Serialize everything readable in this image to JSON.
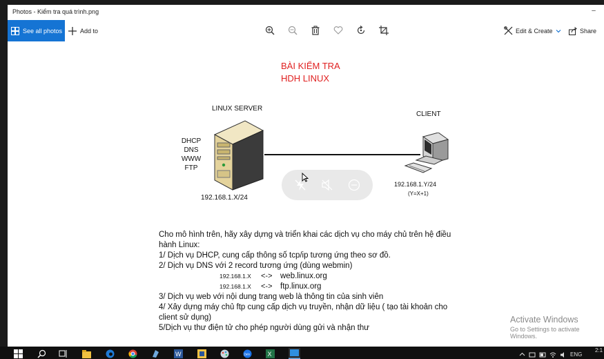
{
  "window": {
    "title": "Photos - Kiểm tra quá trình.png",
    "minimize_glyph": "–"
  },
  "toolbar": {
    "see_all_photos_label": "See all photos",
    "add_to_label": "Add to",
    "edit_create_label": "Edit & Create",
    "share_label": "Share",
    "accent_color": "#1574d4",
    "icons": [
      "zoom-in-icon",
      "zoom-out-icon",
      "delete-icon",
      "favorite-icon",
      "rotate-icon",
      "crop-icon"
    ]
  },
  "document": {
    "title_line1": "BÀI KIỂM TRA",
    "title_line2": "HDH LINUX",
    "title_color": "#e02020",
    "server_label": "LINUX SERVER",
    "client_label": "CLIENT",
    "services": [
      "DHCP",
      "DNS",
      "WWW",
      "FTP"
    ],
    "server_ip": "192.168.1.X/24",
    "client_ip": "192.168.1.Y/24",
    "client_formula": "(Y=X+1)",
    "body": {
      "line1": "Cho mô hình trên, hãy xây dựng và triển khai các dịch vụ cho máy chủ trên hệ điều",
      "line2": "hành Linux:",
      "line3": "1/ Dịch vụ DHCP, cung cấp thông số tcp/ip tương ứng theo sơ đồ.",
      "line4": "2/ Dịch vụ DNS với 2 record tương ứng (dùng webmin)",
      "record1_ip": "192.168.1.X",
      "record1_arrow": "<->",
      "record1_name": "web.linux.org",
      "record2_ip": "192.168.1.X",
      "record2_arrow": "<->",
      "record2_name": "ftp.linux.org",
      "line5": "3/ Dịch vụ web với nội dung trang web là thông tin của sinh viên",
      "line6": "4/ Xây dựng máy chủ  ftp cung cấp dịch vụ truyền, nhận dữ liệu ( tạo tài khoản cho",
      "line7": "client sử dụng)",
      "line8": "5/Dịch vụ thư điện tử cho phép người dùng gửi và nhận thư"
    }
  },
  "watermark": {
    "line1": "Activate Windows",
    "line2": "Go to Settings to activate Windows."
  },
  "taskbar": {
    "apps": [
      "windows-start-icon",
      "search-icon",
      "task-view-icon",
      "file-explorer-icon",
      "edge-icon",
      "chrome-icon",
      "app-icon",
      "word-icon",
      "notes-icon",
      "paint-icon",
      "zalo-icon",
      "excel-icon",
      "photos-icon"
    ],
    "tray_language": "ENG",
    "clock": "2:1"
  }
}
